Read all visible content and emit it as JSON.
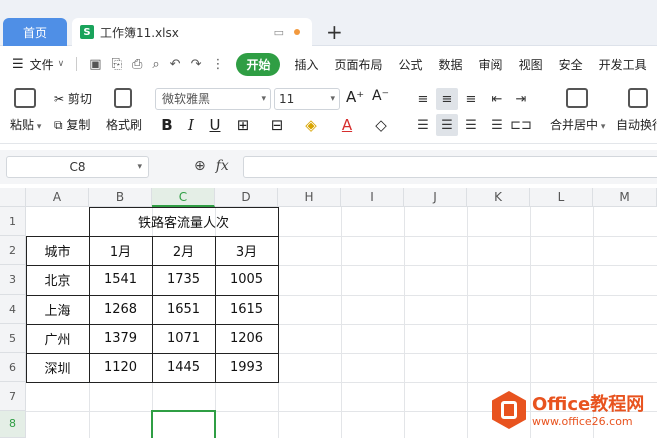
{
  "tabs": {
    "home": "首页",
    "file": "工作簿11.xlsx",
    "file_icon": "S",
    "new_tab": "+"
  },
  "menu": {
    "file": "文件",
    "start": "开始",
    "items": [
      "插入",
      "页面布局",
      "公式",
      "数据",
      "审阅",
      "视图",
      "安全",
      "开发工具"
    ]
  },
  "ribbon": {
    "paste": "粘贴",
    "cut": "剪切",
    "copy": "复制",
    "format_painter": "格式刷",
    "font_name": "微软雅黑",
    "font_size": "11",
    "bold": "B",
    "italic": "I",
    "underline": "U",
    "merge_center": "合并居中",
    "auto_wrap": "自动换行"
  },
  "formula_bar": {
    "name_box": "C8",
    "fx": "fx",
    "value": ""
  },
  "sheet": {
    "columns": [
      "A",
      "B",
      "C",
      "D",
      "H",
      "I",
      "J",
      "K",
      "L",
      "M"
    ],
    "rows": [
      "1",
      "2",
      "3",
      "4",
      "5",
      "6",
      "7",
      "8",
      "9"
    ],
    "selected_cell": "C8",
    "table_title": "铁路客流量人次",
    "header": [
      "城市",
      "1月",
      "2月",
      "3月"
    ],
    "data": [
      [
        "北京",
        "1541",
        "1735",
        "1005"
      ],
      [
        "上海",
        "1268",
        "1651",
        "1615"
      ],
      [
        "广州",
        "1379",
        "1071",
        "1206"
      ],
      [
        "深圳",
        "1120",
        "1445",
        "1993"
      ]
    ]
  },
  "watermark": {
    "title": "Office教程网",
    "url": "www.office26.com"
  },
  "colors": {
    "accent_green": "#2f9e44",
    "tab_blue": "#4f8fe6",
    "watermark_orange": "#e8531f"
  }
}
